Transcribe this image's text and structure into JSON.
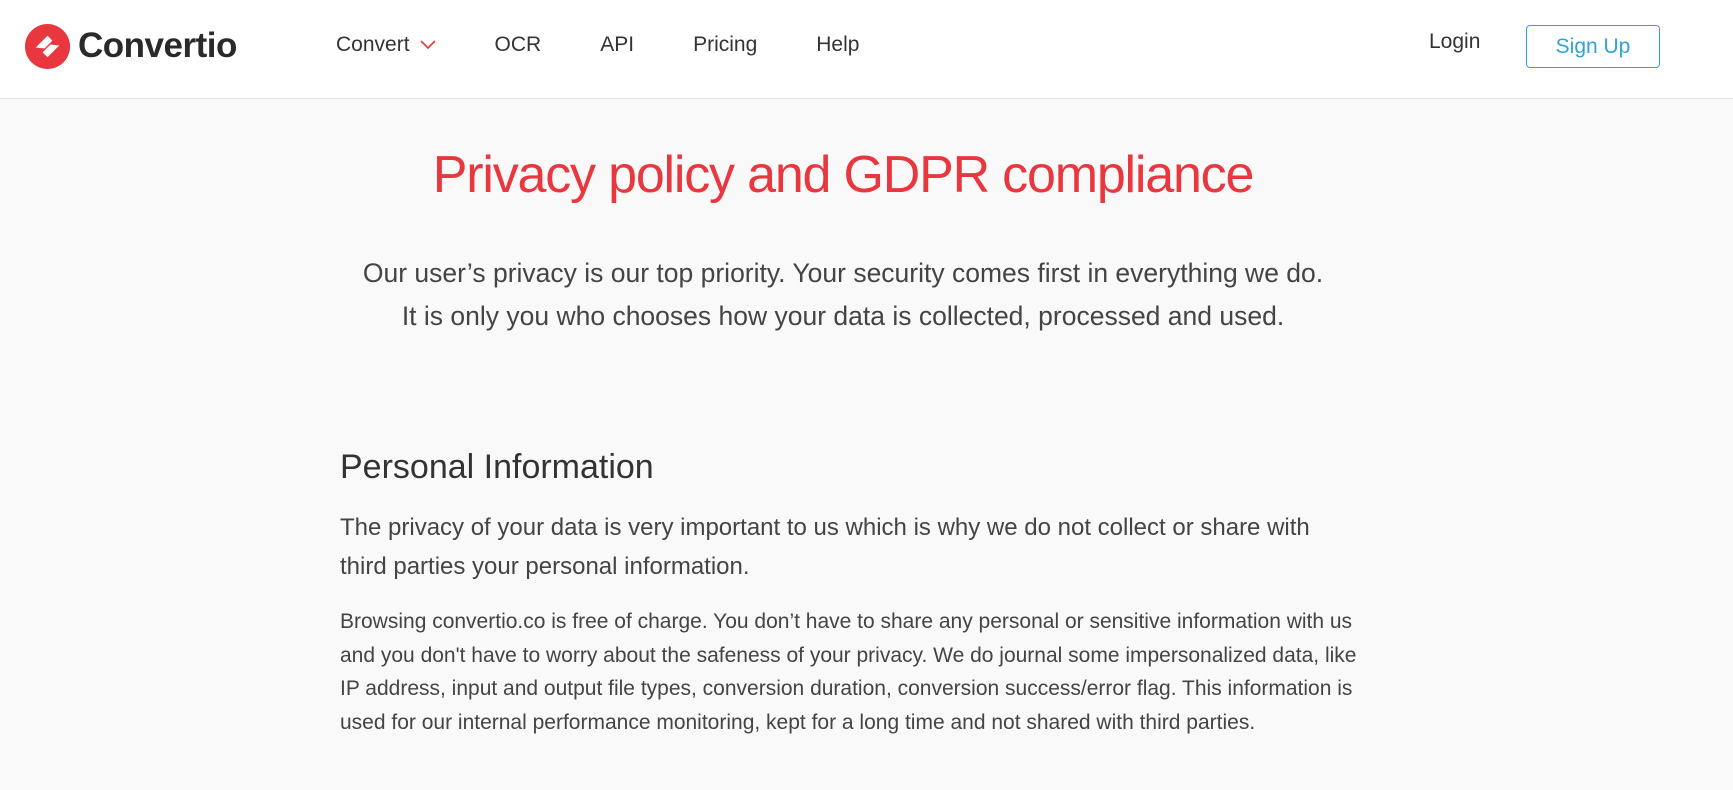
{
  "header": {
    "logo_text": "Convertio",
    "nav": [
      {
        "label": "Convert"
      },
      {
        "label": "OCR"
      },
      {
        "label": "API"
      },
      {
        "label": "Pricing"
      },
      {
        "label": "Help"
      }
    ],
    "login_label": "Login",
    "signup_label": "Sign Up"
  },
  "colors": {
    "brand_red": "#e8373f",
    "signup_blue": "#2fa3d6"
  },
  "main": {
    "title": "Privacy policy and GDPR compliance",
    "intro_line1": "Our user’s privacy is our top priority. Your security comes first in everything we do.",
    "intro_line2": "It is only you who chooses how your data is collected, processed and used.",
    "section": {
      "title": "Personal Information",
      "lead": "The privacy of your data is very important to us which is why we do not collect or share with third parties your personal information.",
      "body": "Browsing convertio.co is free of charge. You don’t have to share any personal or sensitive information with us and you don't have to worry about the safeness of your privacy. We do journal some impersonalized data, like IP address, input and output file types, conversion duration, conversion success/error flag. This information is used for our internal performance monitoring, kept for a long time and not shared with third parties."
    }
  }
}
